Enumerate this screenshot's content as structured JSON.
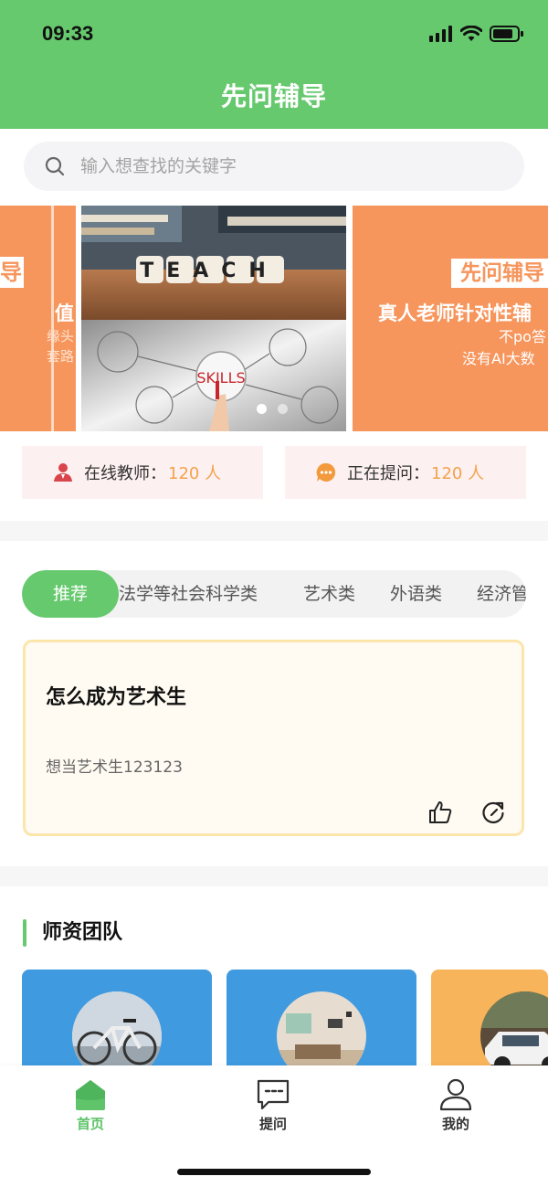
{
  "status_bar": {
    "time": "09:33"
  },
  "app": {
    "title": "先问辅导"
  },
  "search": {
    "placeholder": "输入想查找的关键字"
  },
  "banner": {
    "center_words": {
      "teach": "TEACH",
      "skills": "SKILLS"
    },
    "left_slide": {
      "tag": "导",
      "line1": "值",
      "line2": "缘头",
      "line3": "套路"
    },
    "right_slide": {
      "tag": "先问辅导",
      "line1": "真人老师针对性辅",
      "line2": "不po答",
      "line3": "没有AI大数"
    },
    "dots": 2,
    "active_dot": 1
  },
  "stats": {
    "teachers": {
      "label": "在线教师：",
      "value": "120 人"
    },
    "questions": {
      "label": "正在提问：",
      "value": "120 人"
    }
  },
  "categories": {
    "active": "推荐",
    "items": [
      "法学等社会科学类",
      "艺术类",
      "外语类",
      "经济管"
    ]
  },
  "question": {
    "title": "怎么成为艺术生",
    "description": "想当艺术生123123"
  },
  "teachers_section": {
    "title": "师资团队"
  },
  "tab_bar": {
    "home": "首页",
    "ask": "提问",
    "mine": "我的"
  },
  "colors": {
    "primary": "#66c96e",
    "banner_orange": "#f6955c",
    "stat_value": "#f3a24b"
  }
}
